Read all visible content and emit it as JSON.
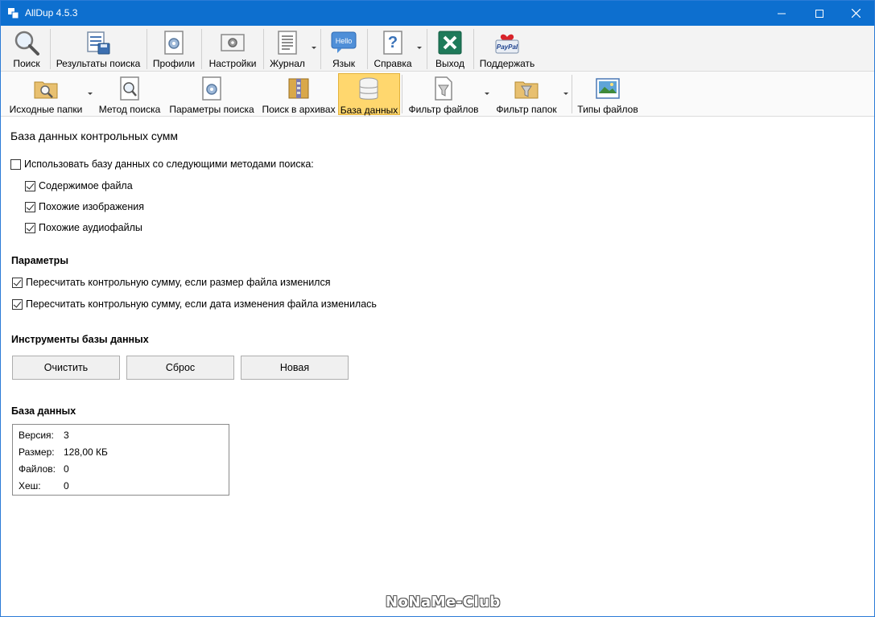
{
  "window": {
    "title": "AllDup 4.5.3"
  },
  "toolbar_main": [
    {
      "label": "Поиск",
      "icon": "magnifier-icon"
    },
    {
      "label": "Результаты поиска",
      "icon": "results-icon"
    },
    {
      "label": "Профили",
      "icon": "profiles-icon"
    },
    {
      "label": "Настройки",
      "icon": "settings-icon"
    },
    {
      "label": "Журнал",
      "icon": "log-icon"
    },
    {
      "label": "Язык",
      "icon": "hello-bubble-icon",
      "icon_text": "Hello"
    },
    {
      "label": "Справка",
      "icon": "help-icon",
      "icon_text": "?"
    },
    {
      "label": "Выход",
      "icon": "exit-icon"
    },
    {
      "label": "Поддержать",
      "icon": "paypal-icon",
      "icon_text": "PayPal"
    }
  ],
  "toolbar_secondary": [
    {
      "label": "Исходные папки",
      "icon": "folder-search-icon"
    },
    {
      "label": "Метод поиска",
      "icon": "search-method-icon"
    },
    {
      "label": "Параметры поиска",
      "icon": "search-options-icon"
    },
    {
      "label": "Поиск в архивах",
      "icon": "archive-icon"
    },
    {
      "label": "База данных",
      "icon": "database-icon",
      "active": true
    },
    {
      "label": "Фильтр файлов",
      "icon": "file-filter-icon"
    },
    {
      "label": "Фильтр папок",
      "icon": "folder-filter-icon"
    },
    {
      "label": "Типы файлов",
      "icon": "file-types-icon"
    }
  ],
  "content": {
    "title": "База данных контрольных сумм",
    "use_db_label": "Использовать базу данных со следующими методами поиска:",
    "methods": [
      {
        "label": "Содержимое файла",
        "checked": true
      },
      {
        "label": "Похожие изображения",
        "checked": true
      },
      {
        "label": "Похожие аудиофайлы",
        "checked": true
      }
    ],
    "params_header": "Параметры",
    "params": [
      {
        "label": "Пересчитать контрольную сумму, если размер файла изменился",
        "checked": true
      },
      {
        "label": "Пересчитать контрольную сумму, если дата изменения файла изменилась",
        "checked": true
      }
    ],
    "tools_header": "Инструменты базы данных",
    "buttons": [
      "Очистить",
      "Сброс",
      "Новая"
    ],
    "db_header": "База данных",
    "db_info": [
      {
        "key": "Версия:",
        "value": "3"
      },
      {
        "key": "Размер:",
        "value": "128,00 КБ"
      },
      {
        "key": "Файлов:",
        "value": "0"
      },
      {
        "key": "Хеш:",
        "value": "0"
      }
    ]
  },
  "watermark": "NoNaMe-Club",
  "colors": {
    "titlebar": "#0d6fcf",
    "active_tab": "#ffd76e"
  }
}
